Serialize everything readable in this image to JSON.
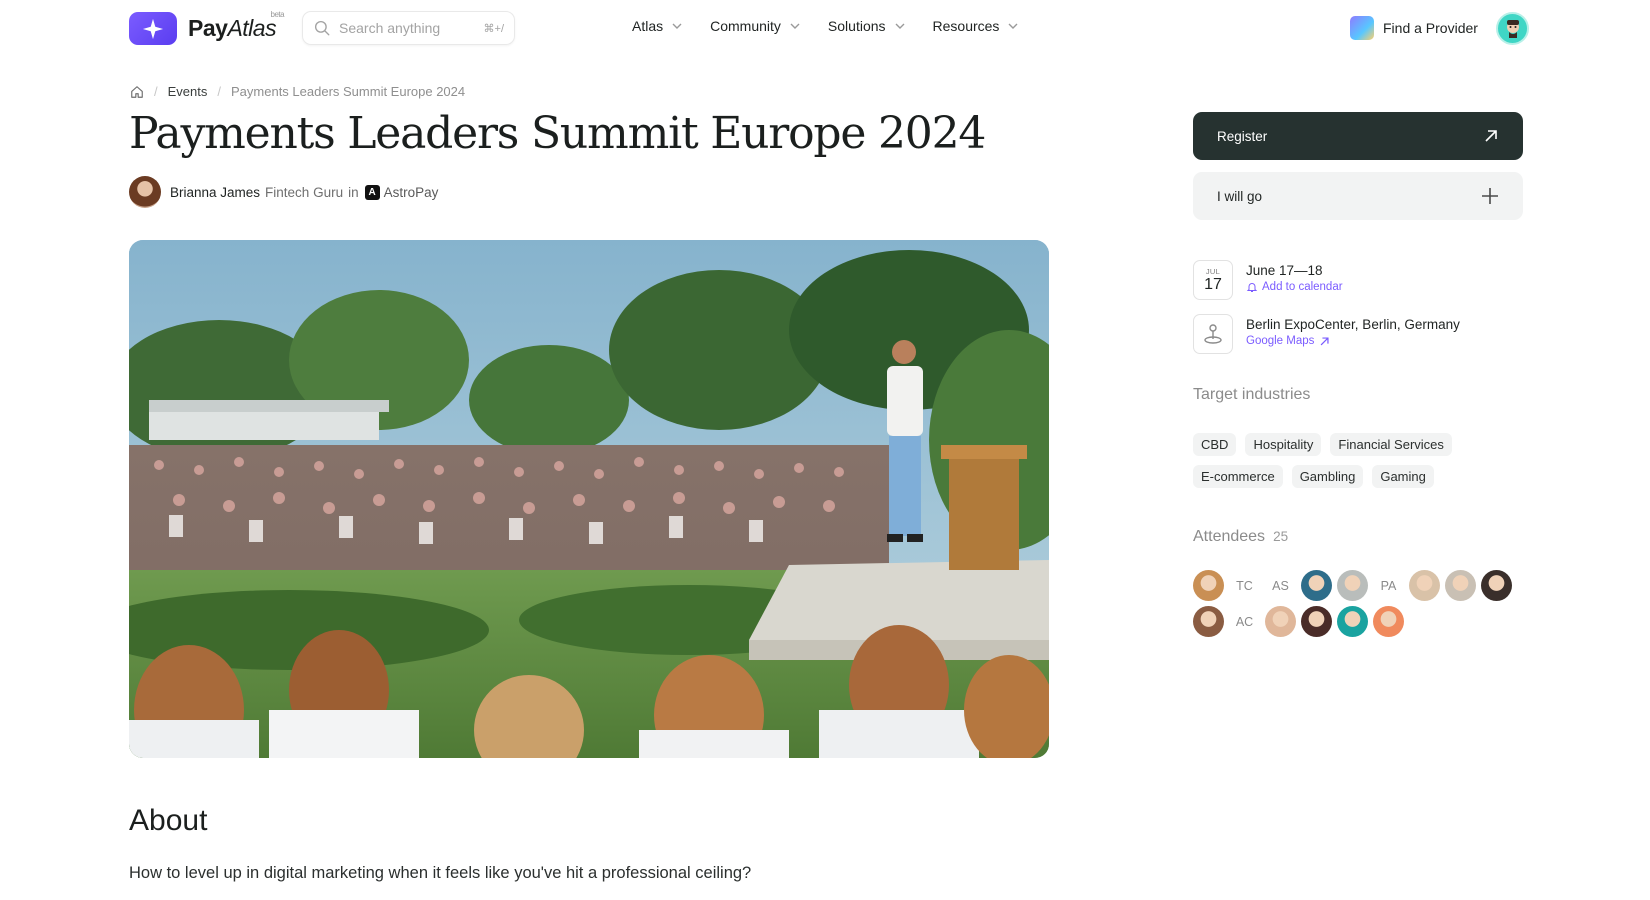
{
  "header": {
    "logo_text": "Pay",
    "logo_text_italic": "Atlas",
    "logo_badge": "beta",
    "search": {
      "placeholder": "Search anything",
      "shortcut": "⌘+/"
    },
    "nav": [
      {
        "label": "Atlas"
      },
      {
        "label": "Community"
      },
      {
        "label": "Solutions"
      },
      {
        "label": "Resources"
      }
    ],
    "find_provider": "Find a Provider"
  },
  "breadcrumb": {
    "items": [
      "Events",
      "Payments Leaders Summit Europe 2024"
    ]
  },
  "event": {
    "title": "Payments Leaders Summit Europe 2024",
    "author": {
      "name": "Brianna James",
      "role": "Fintech Guru",
      "connector": "in",
      "company": "AstroPay",
      "company_initial": "A"
    }
  },
  "about": {
    "title": "About",
    "text": "How to level up in digital marketing when it feels like you've hit a professional ceiling?"
  },
  "sidebar": {
    "register_label": "Register",
    "go_label": "I will go",
    "date": {
      "month": "JUL",
      "day": "17",
      "range": "June 17—18",
      "calendar_link": "Add to calendar"
    },
    "location": {
      "name": "Berlin ExpoCenter, Berlin, Germany",
      "map_link": "Google Maps"
    },
    "industries_label": "Target industries",
    "industries": [
      "CBD",
      "Hospitality",
      "Financial Services",
      "E-commerce",
      "Gambling",
      "Gaming"
    ],
    "attendees_label": "Attendees",
    "attendees_count": "25",
    "attendees": [
      {
        "type": "photo",
        "color": "#c98f54"
      },
      {
        "type": "initials",
        "text": "TC"
      },
      {
        "type": "initials",
        "text": "AS"
      },
      {
        "type": "photo",
        "color": "#2e6d8a"
      },
      {
        "type": "photo",
        "color": "#b9bdbb"
      },
      {
        "type": "initials",
        "text": "PA"
      },
      {
        "type": "photo",
        "color": "#d9c2a8"
      },
      {
        "type": "photo",
        "color": "#c9c0b4"
      },
      {
        "type": "photo",
        "color": "#3a2f2b"
      },
      {
        "type": "photo",
        "color": "#8a5c42"
      },
      {
        "type": "initials",
        "text": "AC"
      },
      {
        "type": "photo",
        "color": "#e0b79a"
      },
      {
        "type": "photo",
        "color": "#4a2c28"
      },
      {
        "type": "photo",
        "color": "#1aa3a0"
      },
      {
        "type": "photo",
        "color": "#f08a5d"
      }
    ]
  },
  "colors": {
    "accent": "#7b5cff",
    "primary_button": "#263230",
    "secondary_button": "#f2f3f3",
    "tag_bg": "#f2f3f3"
  }
}
